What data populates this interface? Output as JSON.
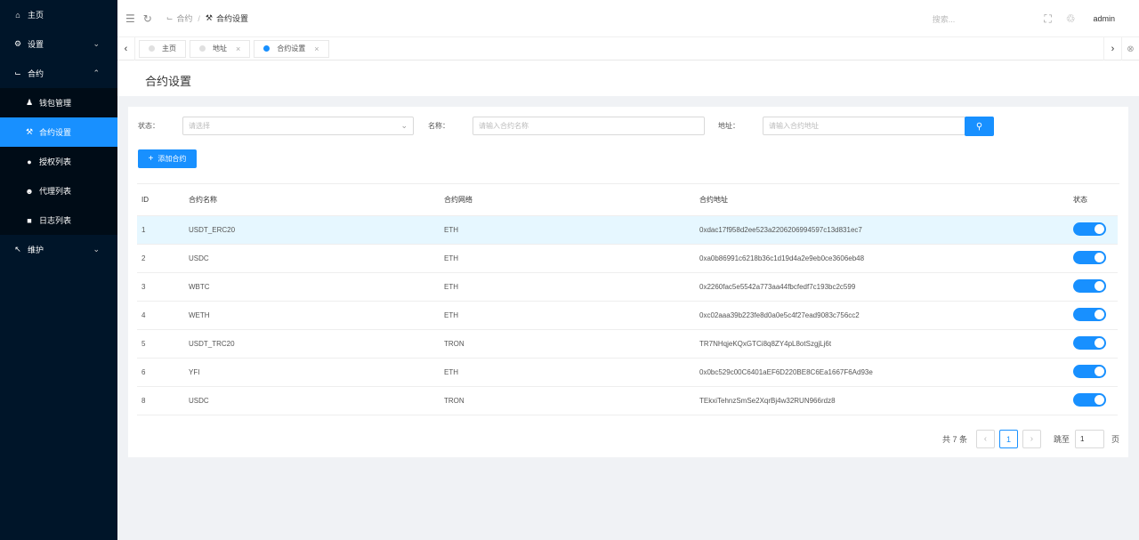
{
  "sidebar": {
    "items": [
      {
        "label": "主页",
        "icon": "home-icon"
      },
      {
        "label": "设置",
        "icon": "gear-icon"
      },
      {
        "label": "合约",
        "icon": "contract-icon"
      },
      {
        "label": "维护",
        "icon": "wrench-icon"
      }
    ],
    "submenu": [
      {
        "label": "钱包管理",
        "icon": "wallet-icon"
      },
      {
        "label": "合约设置",
        "icon": "tools-icon",
        "active": true
      },
      {
        "label": "授权列表",
        "icon": "circle-icon"
      },
      {
        "label": "代理列表",
        "icon": "user-icon"
      },
      {
        "label": "日志列表",
        "icon": "log-icon"
      }
    ]
  },
  "header": {
    "breadcrumb": [
      "合约",
      "合约设置"
    ],
    "search_placeholder": "搜索...",
    "user": "admin"
  },
  "tabs": [
    {
      "label": "主页",
      "closable": false
    },
    {
      "label": "地址",
      "closable": true
    },
    {
      "label": "合约设置",
      "closable": true,
      "active": true
    }
  ],
  "page": {
    "title": "合约设置"
  },
  "filters": {
    "status_label": "状态：",
    "status_placeholder": "请选择",
    "name_label": "名称：",
    "name_placeholder": "请输入合约名称",
    "address_label": "地址：",
    "address_placeholder": "请输入合约地址"
  },
  "add_button": "添加合约",
  "table": {
    "headers": [
      "ID",
      "合约名称",
      "合约网络",
      "合约地址",
      "状态"
    ],
    "rows": [
      {
        "id": "1",
        "name": "USDT_ERC20",
        "network": "ETH",
        "address": "0xdac17f958d2ee523a2206206994597c13d831ec7",
        "enabled": true
      },
      {
        "id": "2",
        "name": "USDC",
        "network": "ETH",
        "address": "0xa0b86991c6218b36c1d19d4a2e9eb0ce3606eb48",
        "enabled": true
      },
      {
        "id": "3",
        "name": "WBTC",
        "network": "ETH",
        "address": "0x2260fac5e5542a773aa44fbcfedf7c193bc2c599",
        "enabled": true
      },
      {
        "id": "4",
        "name": "WETH",
        "network": "ETH",
        "address": "0xc02aaa39b223fe8d0a0e5c4f27ead9083c756cc2",
        "enabled": true
      },
      {
        "id": "5",
        "name": "USDT_TRC20",
        "network": "TRON",
        "address": "TR7NHqjeKQxGTCi8q8ZY4pL8otSzgjLj6t",
        "enabled": true
      },
      {
        "id": "6",
        "name": "YFI",
        "network": "ETH",
        "address": "0x0bc529c00C6401aEF6D220BE8C6Ea1667F6Ad93e",
        "enabled": true
      },
      {
        "id": "8",
        "name": "USDC",
        "network": "TRON",
        "address": "TEkxiTehnzSmSe2XqrBj4w32RUN966rdz8",
        "enabled": true
      }
    ]
  },
  "pagination": {
    "total_text": "共 7 条",
    "current_page": "1",
    "jump_label": "跳至",
    "jump_value": "1",
    "page_suffix": "页"
  },
  "colors": {
    "sidebar_bg": "#001529",
    "accent": "#1890ff",
    "row_highlight": "#e6f7ff"
  }
}
